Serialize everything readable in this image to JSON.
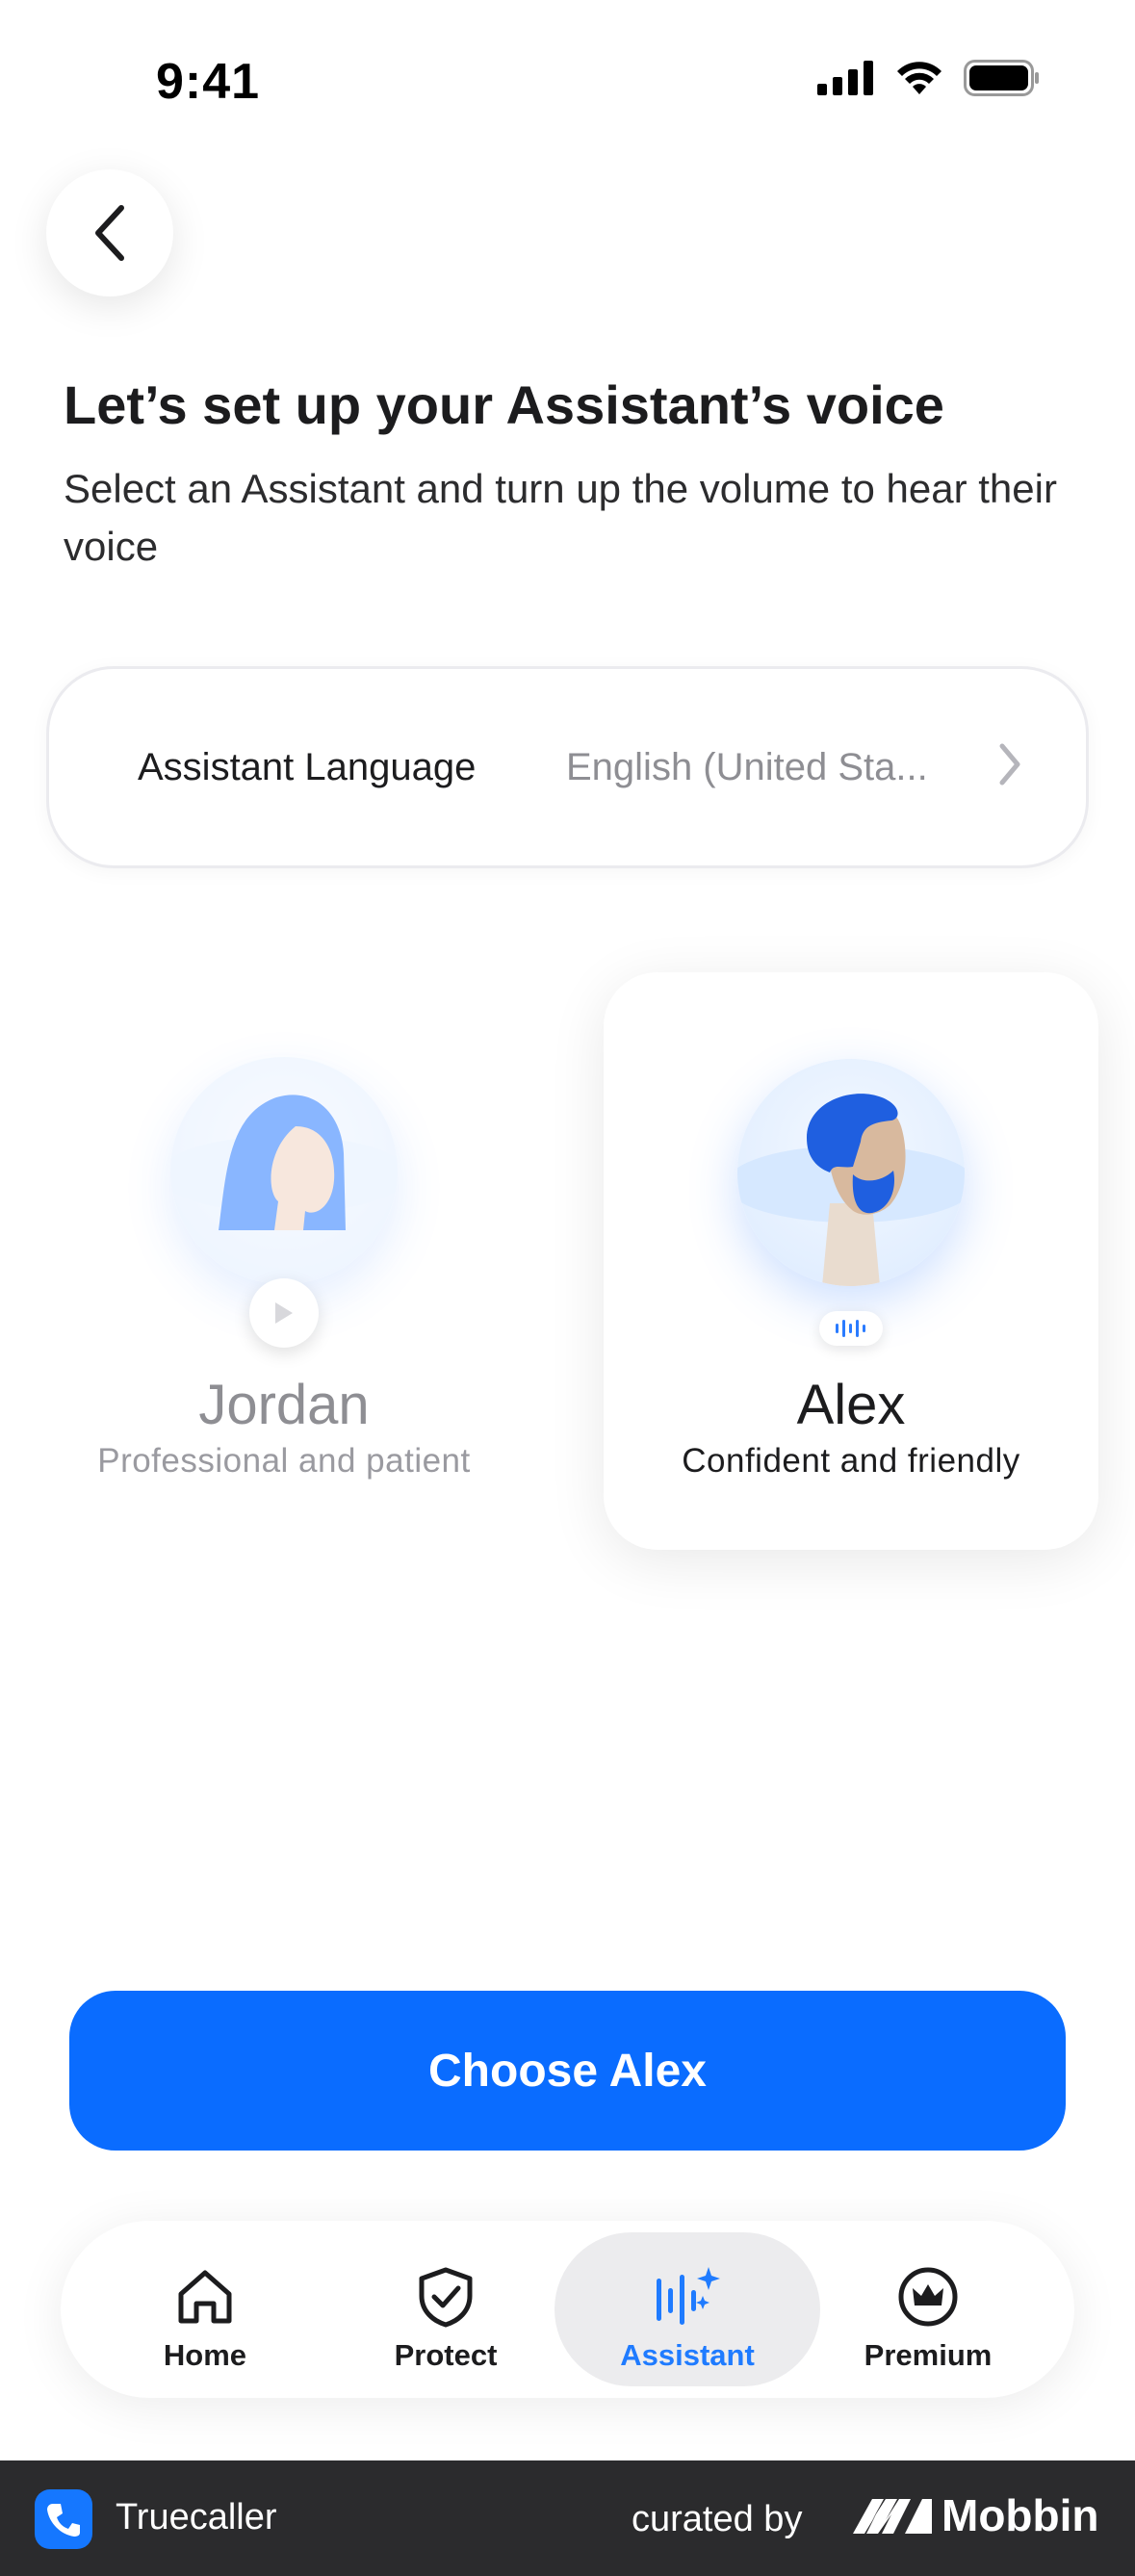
{
  "status_bar": {
    "time": "9:41"
  },
  "header": {
    "title": "Let’s set up your Assistant’s voice",
    "subtitle": "Select an Assistant and turn up the volume to hear their voice"
  },
  "language": {
    "label": "Assistant Language",
    "value": "English (United Sta..."
  },
  "assistants": [
    {
      "name": "Jordan",
      "description": "Professional and patient",
      "selected": false
    },
    {
      "name": "Alex",
      "description": "Confident and friendly",
      "selected": true
    }
  ],
  "cta": {
    "label": "Choose Alex"
  },
  "tabs": [
    {
      "label": "Home",
      "icon": "home-icon",
      "active": false
    },
    {
      "label": "Protect",
      "icon": "shield-check-icon",
      "active": false
    },
    {
      "label": "Assistant",
      "icon": "sparkle-waveform-icon",
      "active": true
    },
    {
      "label": "Premium",
      "icon": "crown-icon",
      "active": false
    }
  ],
  "footer": {
    "app_name": "Truecaller",
    "curated_by": "curated by",
    "brand": "Mobbin"
  },
  "colors": {
    "accent": "#0a6cff",
    "active_tab_text": "#1f7bff",
    "footer_bg": "#2b2b2d"
  }
}
